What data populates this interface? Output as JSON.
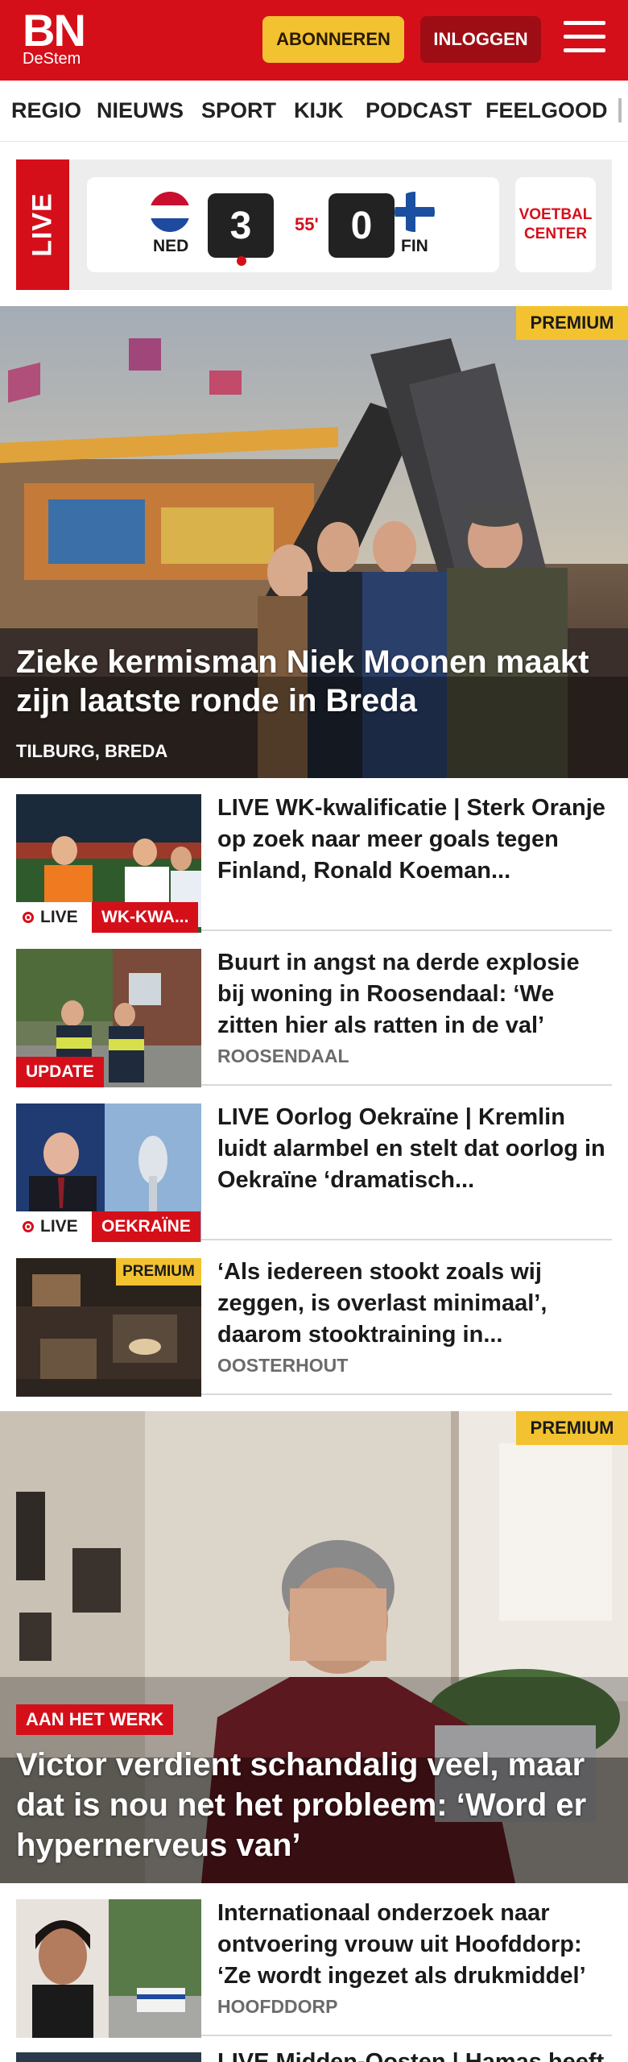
{
  "header": {
    "logo_main": "BN",
    "logo_sub": "DeStem",
    "subscribe_label": "ABONNEREN",
    "login_label": "INLOGGEN",
    "brand_color": "#d50f1a",
    "accent_color": "#f2c230"
  },
  "nav": {
    "items": [
      "REGIO",
      "NIEUWS",
      "SPORT",
      "KIJK",
      "PODCAST",
      "FEELGOOD"
    ]
  },
  "live_match": {
    "live_label": "LIVE",
    "home_team": "NED",
    "away_team": "FIN",
    "home_score": "3",
    "away_score": "0",
    "minute": "55'",
    "center_label": "VOETBAL CENTER"
  },
  "hero": {
    "badge": "PREMIUM",
    "title": "Zieke kermisman Niek Moonen maakt zijn laatste ronde in Breda",
    "location": "TILBURG, BREDA"
  },
  "articles": [
    {
      "title": "LIVE WK-kwalificatie | Sterk Oranje op zoek naar meer goals tegen Finland, Ronald Koeman...",
      "live": "LIVE",
      "tag": "WK-KWA..."
    },
    {
      "title": "Buurt in angst na derde explosie bij woning in Roosendaal: ‘We zitten hier als ratten in de val’",
      "tag": "UPDATE",
      "location": "ROOSENDAAL"
    },
    {
      "title": "LIVE Oorlog Oekraïne | Kremlin luidt alarmbel en stelt dat oorlog in Oekraïne ‘dramatisch...",
      "live": "LIVE",
      "tag": "OEKRAÏNE"
    },
    {
      "title": "‘Als iedereen stookt zoals wij zeggen, is overlast minimaal’, daarom stooktraining in...",
      "badge": "PREMIUM",
      "location": "OOSTERHOUT"
    }
  ],
  "hero2": {
    "badge": "PREMIUM",
    "tag": "AAN HET WERK",
    "title": "Victor verdient schandalig veel, maar dat is nou net het probleem: ‘Word er hypernerveus van’"
  },
  "article_after": {
    "title": "Internationaal onderzoek naar ontvoering vrouw uit Hoofddorp: ‘Ze wordt ingezet als drukmiddel’",
    "location": "HOOFDDORP"
  },
  "partial": {
    "title": "LIVE Midden-Oosten | Hamas heeft"
  }
}
